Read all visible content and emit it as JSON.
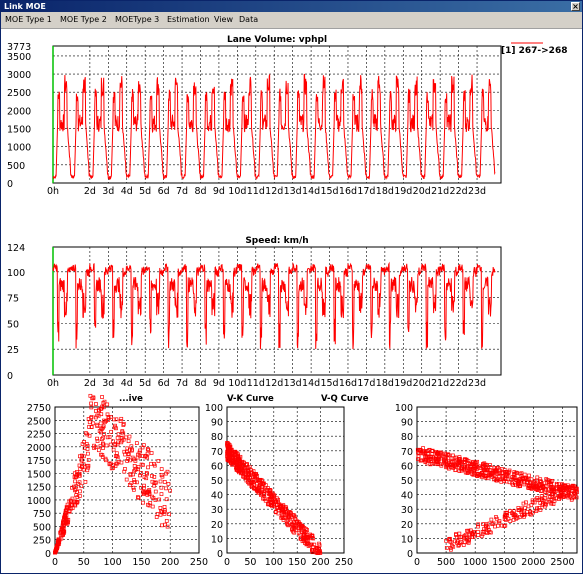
{
  "window": {
    "title": "Link MOE",
    "close_glyph": "×"
  },
  "menu": {
    "items": [
      "MOE Type 1",
      "MOE Type 2",
      "MOEType 3",
      "Estimation",
      "View",
      "Data"
    ]
  },
  "colors": {
    "series": "#ff0000",
    "grid": "#000000",
    "axis_highlight": "#00c000",
    "background": "#ffffff"
  },
  "legend": {
    "entry": "[1] 267->268"
  },
  "chart_data": [
    {
      "type": "line",
      "title": "Lane Volume: vphpl",
      "xlabel": "",
      "ylabel": "",
      "x_tick_labels": [
        "0h",
        "2d",
        "3d",
        "4d",
        "5d",
        "6d",
        "7d",
        "8d",
        "9d",
        "10d",
        "11d",
        "12d",
        "13d",
        "14d",
        "15d",
        "16d",
        "17d",
        "18d",
        "19d",
        "20d",
        "21d",
        "22d",
        "23d"
      ],
      "y_tick_labels": [
        "3773",
        "3500",
        "3000",
        "2500",
        "2000",
        "1500",
        "1000",
        "500",
        "0"
      ],
      "y_ticks": [
        3773,
        3500,
        3000,
        2500,
        2000,
        1500,
        1000,
        500,
        0
      ],
      "ylim": [
        0,
        3773
      ],
      "xlim": [
        0,
        24.3
      ],
      "grid": true,
      "series": [
        {
          "name": "[1] 267->268",
          "x_unit": "day",
          "daily_min": 0,
          "daily_am_peak": 2400,
          "daily_pm_peak": 2700,
          "days": 24
        }
      ]
    },
    {
      "type": "line",
      "title": "Speed: km/h",
      "xlabel": "",
      "ylabel": "",
      "x_tick_labels": [
        "0h",
        "2d",
        "3d",
        "4d",
        "5d",
        "6d",
        "7d",
        "8d",
        "9d",
        "10d",
        "11d",
        "12d",
        "13d",
        "14d",
        "15d",
        "16d",
        "17d",
        "18d",
        "19d",
        "20d",
        "21d",
        "22d",
        "23d"
      ],
      "y_tick_labels": [
        "124",
        "100",
        "75",
        "50",
        "25",
        "0"
      ],
      "y_ticks": [
        124,
        100,
        75,
        50,
        25,
        0
      ],
      "ylim": [
        0,
        124
      ],
      "xlim": [
        0,
        24.3
      ],
      "grid": true,
      "series": [
        {
          "name": "[1] 267->268",
          "x_unit": "day",
          "free_flow": 100,
          "am_dip": 25,
          "pm_dip": 55
        }
      ]
    },
    {
      "type": "scatter",
      "title": "Q-K Curve",
      "visible_title": "...ive",
      "x_tick_labels": [
        "0",
        "50",
        "100",
        "150",
        "200",
        "250"
      ],
      "y_tick_labels": [
        "2750",
        "2500",
        "2250",
        "2000",
        "1750",
        "1500",
        "1250",
        "1000",
        "750",
        "500",
        "250",
        "0"
      ],
      "xlim": [
        0,
        250
      ],
      "ylim": [
        0,
        2750
      ],
      "grid": true
    },
    {
      "type": "scatter",
      "title": "V-K Curve",
      "x_tick_labels": [
        "0",
        "50",
        "100",
        "150",
        "200",
        "250"
      ],
      "y_tick_labels": [
        "100",
        "90",
        "80",
        "70",
        "60",
        "50",
        "40",
        "30",
        "20",
        "10",
        "0"
      ],
      "xlim": [
        0,
        250
      ],
      "ylim": [
        0,
        100
      ],
      "grid": true
    },
    {
      "type": "scatter",
      "title": "V-Q Curve",
      "x_tick_labels": [
        "0",
        "500",
        "1000",
        "1500",
        "2000",
        "2500"
      ],
      "y_tick_labels": [
        "100",
        "90",
        "80",
        "70",
        "60",
        "50",
        "40",
        "30",
        "20",
        "10",
        "0"
      ],
      "xlim": [
        0,
        2750
      ],
      "ylim": [
        0,
        100
      ],
      "grid": true
    }
  ]
}
